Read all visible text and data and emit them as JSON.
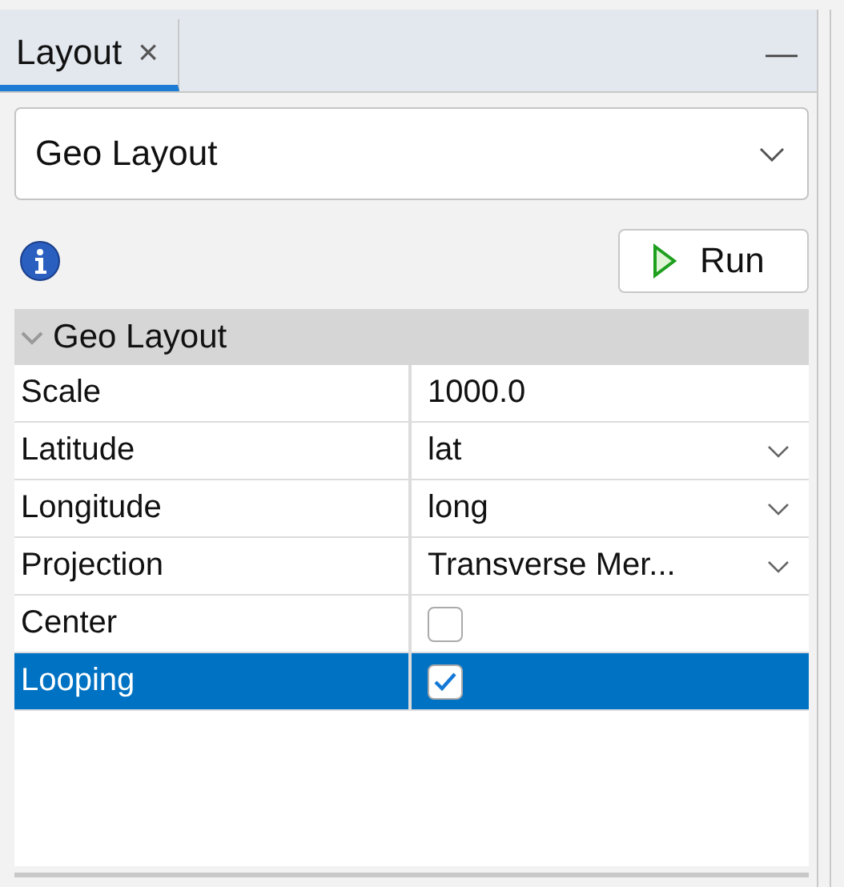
{
  "tabs": [
    {
      "label": "Layout",
      "close": "×",
      "selected": true
    }
  ],
  "minimize": "—",
  "layout_select": {
    "value": "Geo Layout"
  },
  "run_button": {
    "label": "Run"
  },
  "properties": {
    "group": {
      "label": "Geo Layout",
      "expanded": true
    },
    "rows": [
      {
        "name": "Scale",
        "kind": "text",
        "value": "1000.0",
        "selected": false
      },
      {
        "name": "Latitude",
        "kind": "dropdown",
        "value": "lat",
        "selected": false
      },
      {
        "name": "Longitude",
        "kind": "dropdown",
        "value": "long",
        "selected": false
      },
      {
        "name": "Projection",
        "kind": "dropdown",
        "value": "Transverse Mer...",
        "selected": false
      },
      {
        "name": "Center",
        "kind": "checkbox",
        "checked": false,
        "selected": false
      },
      {
        "name": "Looping",
        "kind": "checkbox",
        "checked": true,
        "selected": true
      }
    ]
  }
}
